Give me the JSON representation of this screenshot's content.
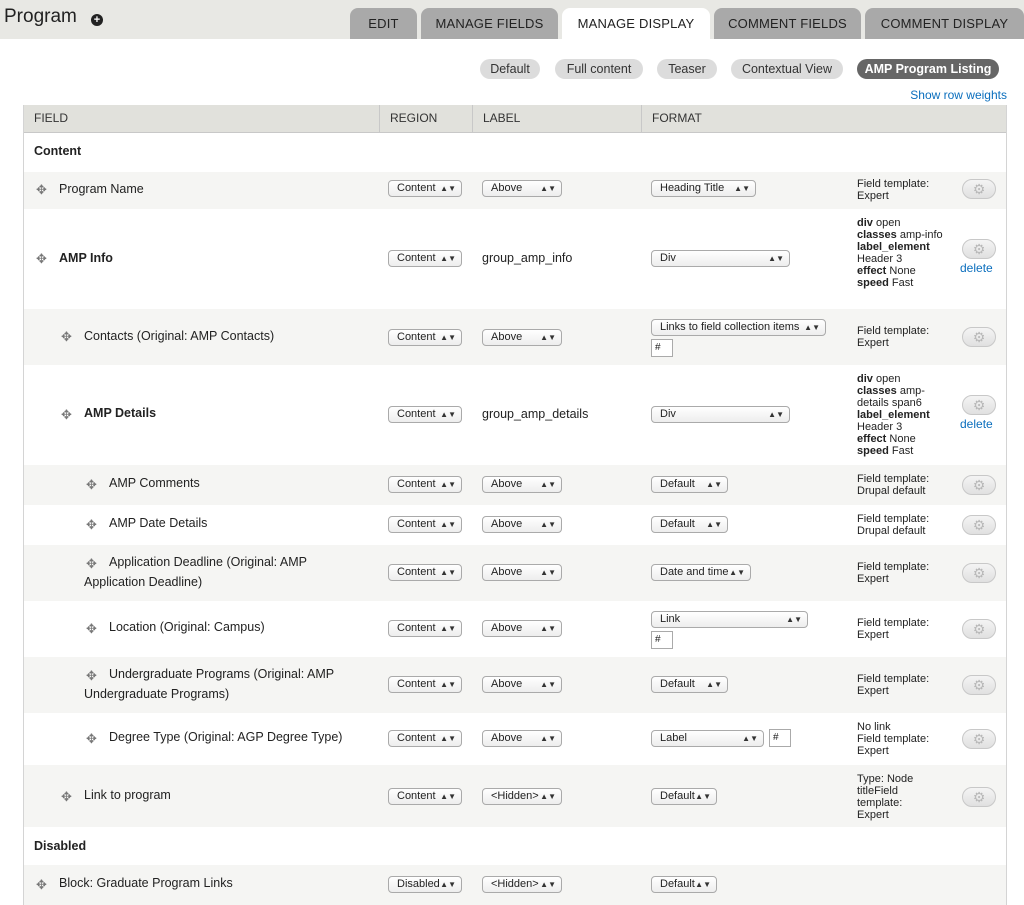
{
  "page": {
    "title": "Program",
    "tabs": [
      "EDIT",
      "MANAGE FIELDS",
      "MANAGE DISPLAY",
      "COMMENT FIELDS",
      "COMMENT DISPLAY"
    ],
    "active_tab": "MANAGE DISPLAY"
  },
  "view_modes": [
    "Default",
    "Full content",
    "Teaser",
    "Contextual View",
    "AMP Program Listing"
  ],
  "active_view_mode": "AMP Program Listing",
  "show_row_weights": "Show row weights",
  "table": {
    "headers": [
      "FIELD",
      "REGION",
      "LABEL",
      "FORMAT"
    ],
    "regions": [
      "Content",
      "Disabled"
    ],
    "rows": [
      {
        "name": "Program Name",
        "region": "Content",
        "label": "Above",
        "format": "Heading Title",
        "summary": [
          "Field template:",
          "Expert"
        ]
      },
      {
        "name": "AMP Info",
        "region": "Content",
        "label_text": "group_amp_info",
        "format": "Div",
        "group_summary": {
          "div": "open",
          "classes": "amp-info",
          "label_element": "Header 3",
          "effect": "None",
          "speed": "Fast"
        },
        "delete": "delete"
      },
      {
        "name": "Contacts (Original: AMP Contacts)",
        "region": "Content",
        "label": "Above",
        "format": "Links to field collection items",
        "extra": "#",
        "summary": [
          "Field template:",
          "Expert"
        ]
      },
      {
        "name": "AMP Details",
        "region": "Content",
        "label_text": "group_amp_details",
        "format": "Div",
        "group_summary": {
          "div": "open",
          "classes": "amp-details span6",
          "label_element": "Header 3",
          "effect": "None",
          "speed": "Fast"
        },
        "delete": "delete"
      },
      {
        "name": "AMP Comments",
        "region": "Content",
        "label": "Above",
        "format": "Default",
        "summary": [
          "Field template:",
          "Drupal default"
        ]
      },
      {
        "name": "AMP Date Details",
        "region": "Content",
        "label": "Above",
        "format": "Default",
        "summary": [
          "Field template:",
          "Drupal default"
        ]
      },
      {
        "name_lines": [
          "Application Deadline (Original: AMP",
          "Application Deadline)"
        ],
        "region": "Content",
        "label": "Above",
        "format": "Date and time",
        "summary": [
          "Field template:",
          "Expert"
        ]
      },
      {
        "name": "Location (Original: Campus)",
        "region": "Content",
        "label": "Above",
        "format": "Link",
        "extra": "#",
        "summary": [
          "Field template:",
          "Expert"
        ]
      },
      {
        "name_lines": [
          "Undergraduate Programs (Original: AMP",
          "Undergraduate Programs)"
        ],
        "region": "Content",
        "label": "Above",
        "format": "Default",
        "summary": [
          "Field template:",
          "Expert"
        ]
      },
      {
        "name": "Degree Type (Original: AGP Degree Type)",
        "region": "Content",
        "label": "Above",
        "format": "Label",
        "extra": "#",
        "summary": [
          "No link",
          "Field template:",
          "Expert"
        ]
      },
      {
        "name": "Link to program",
        "region": "Content",
        "label": "<Hidden>",
        "format": "Default",
        "summary": [
          "Type: Node",
          "titleField",
          "template:",
          "Expert"
        ]
      },
      {
        "name": "Block: Graduate Program Links",
        "region": "Disabled",
        "label": "<Hidden>",
        "format": "Default"
      }
    ]
  },
  "group_keys": {
    "div": "div",
    "classes": "classes",
    "label_element": "label_element",
    "effect": "effect",
    "speed": "speed"
  },
  "icons": {
    "handle": "drag-handle-icon",
    "gear": "gear-icon",
    "shortcut": "add-shortcut-icon"
  },
  "colors": {
    "link": "#0a6ebd",
    "tab_inactive": "#a9a9a9",
    "view_mode_active": "#666666",
    "header_bg": "#e8e8e4"
  }
}
